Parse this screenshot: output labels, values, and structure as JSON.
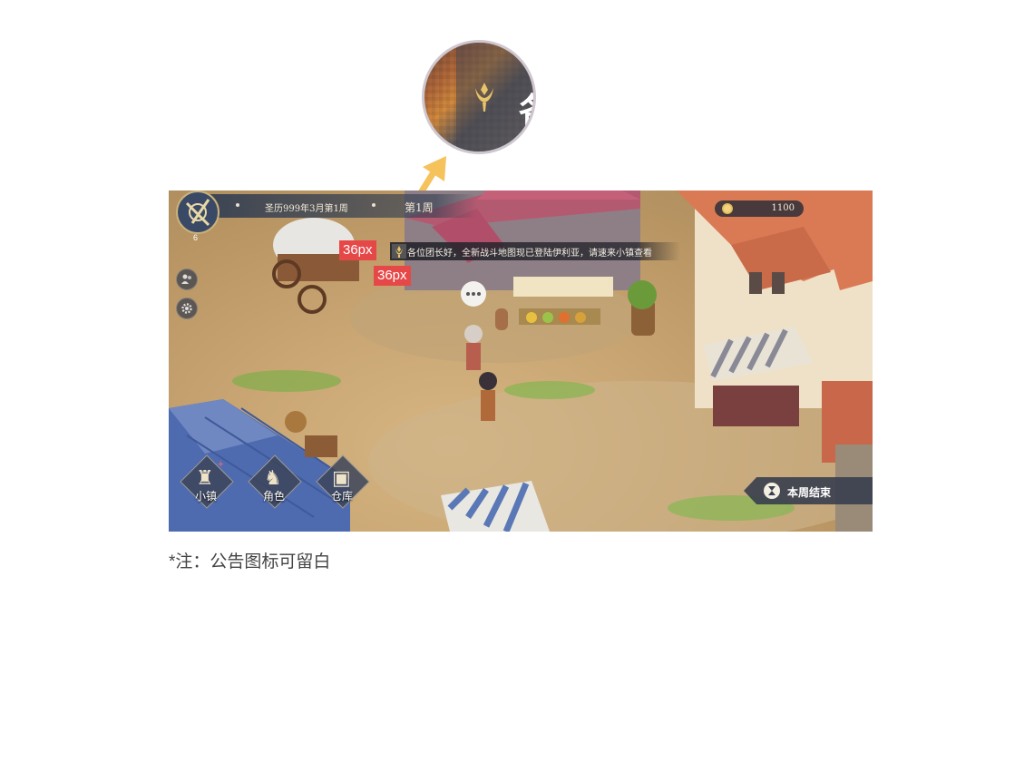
{
  "zoom": {
    "char": "各"
  },
  "game": {
    "topbar": {
      "date": "圣历999年3月第1周",
      "week": "第1周"
    },
    "player": {
      "level": "6"
    },
    "currency": {
      "value": "1100",
      "icon": "coin-icon"
    },
    "notice": {
      "text": "各位团长好，全新战斗地图现已登陆伊利亚，请速来小镇查看",
      "icon": "announcement-icon"
    },
    "annotations": {
      "width_tag": "36px",
      "height_tag": "36px"
    },
    "side_buttons": [
      {
        "icon": "friends-icon"
      },
      {
        "icon": "settings-gear-icon"
      }
    ],
    "nav": [
      {
        "label": "小镇",
        "icon": "castle-icon",
        "badge": "+"
      },
      {
        "label": "角色",
        "icon": "knight-helmet-icon"
      },
      {
        "label": "仓库",
        "icon": "chest-icon"
      }
    ],
    "end_week": {
      "label": "本周结束",
      "icon": "hourglass-icon"
    }
  },
  "footnote": "*注：公告图标可留白",
  "colors": {
    "tag": "#e64848",
    "arrow": "#f5c25c",
    "bar": "#323e52"
  }
}
